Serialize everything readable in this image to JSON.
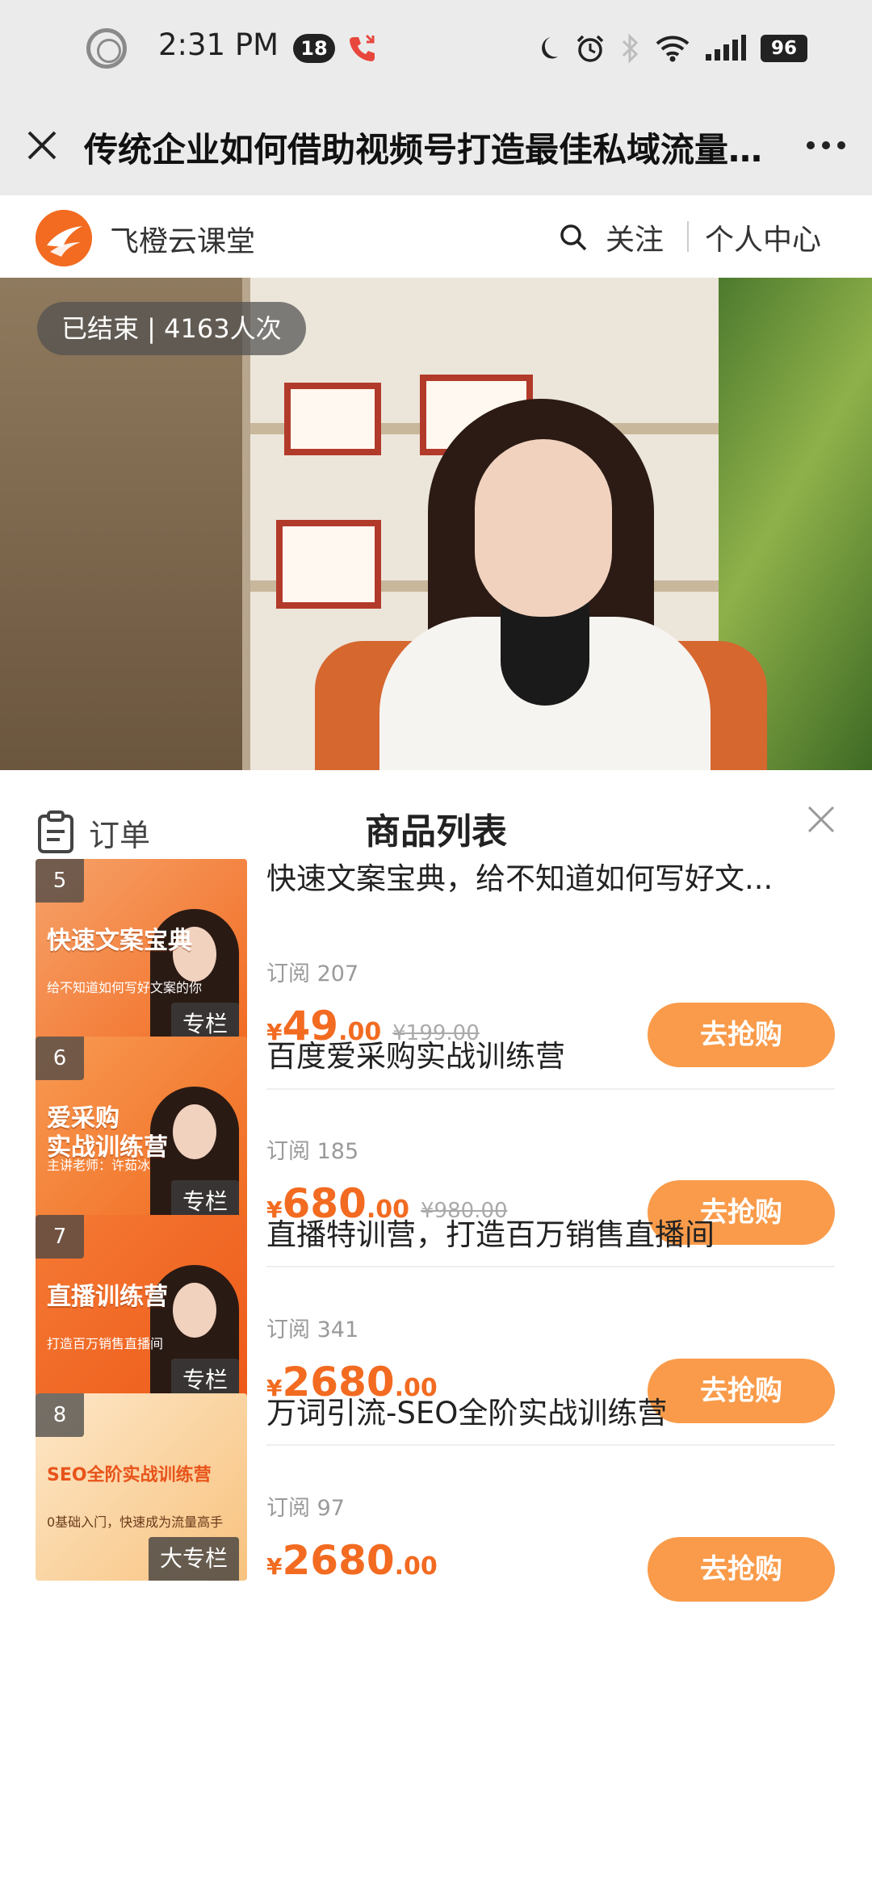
{
  "status_bar": {
    "time": "2:31 PM",
    "notification_count": "18",
    "battery": "96",
    "icons": [
      "ring-icon",
      "missed-call-icon",
      "moon-icon",
      "alarm-icon",
      "bluetooth-icon",
      "wifi-icon",
      "signal-icon",
      "battery-icon"
    ]
  },
  "titlebar": {
    "title": "传统企业如何借助视频号打造最佳私域流量…",
    "close_icon": "close-icon",
    "more_icon": "more-icon"
  },
  "brand": {
    "name": "飞橙云课堂",
    "follow": "关注",
    "me": "个人中心"
  },
  "video": {
    "status_badge": "已结束 | 4163人次"
  },
  "panel": {
    "order_label": "订单",
    "title": "商品列表"
  },
  "colors": {
    "accent": "#f26b21",
    "buy_button": "#f99b4a",
    "topbar": "#ebebeb"
  },
  "products": [
    {
      "index": "5",
      "thumb_title": "快速文案宝典",
      "thumb_sub": "给不知道如何写好文案的你",
      "thumb_colors": [
        "#f6a26a",
        "#f26b21"
      ],
      "tag": "专栏",
      "name": "快速文案宝典，给不知道如何写好文...",
      "subs": "订阅 207",
      "currency": "¥",
      "price_int": "49",
      "price_dec": ".00",
      "orig_price": "¥199.00",
      "buy": "去抢购"
    },
    {
      "index": "6",
      "thumb_title": "爱采购\n实战训练营",
      "thumb_sub": "主讲老师：许茹冰",
      "thumb_colors": [
        "#f89a53",
        "#f06a1f"
      ],
      "tag": "专栏",
      "name": "百度爱采购实战训练营",
      "subs": "订阅 185",
      "currency": "¥",
      "price_int": "680",
      "price_dec": ".00",
      "orig_price": "¥980.00",
      "buy": "去抢购"
    },
    {
      "index": "7",
      "thumb_title": "直播训练营",
      "thumb_sub": "打造百万销售直播间",
      "thumb_colors": [
        "#f47a35",
        "#ee5a18"
      ],
      "tag": "专栏",
      "name": "直播特训营，打造百万销售直播间",
      "subs": "订阅 341",
      "currency": "¥",
      "price_int": "2680",
      "price_dec": ".00",
      "orig_price": "",
      "buy": "去抢购"
    },
    {
      "index": "8",
      "thumb_title": "SEO全阶实战训练营",
      "thumb_sub": "0基础入门，快速成为流量高手",
      "thumb_colors": [
        "#fde7c8",
        "#f8c27e"
      ],
      "tag": "大专栏",
      "name": "万词引流-SEO全阶实战训练营",
      "subs": "订阅 97",
      "currency": "¥",
      "price_int": "2680",
      "price_dec": ".00",
      "orig_price": "",
      "buy": "去抢购"
    }
  ]
}
